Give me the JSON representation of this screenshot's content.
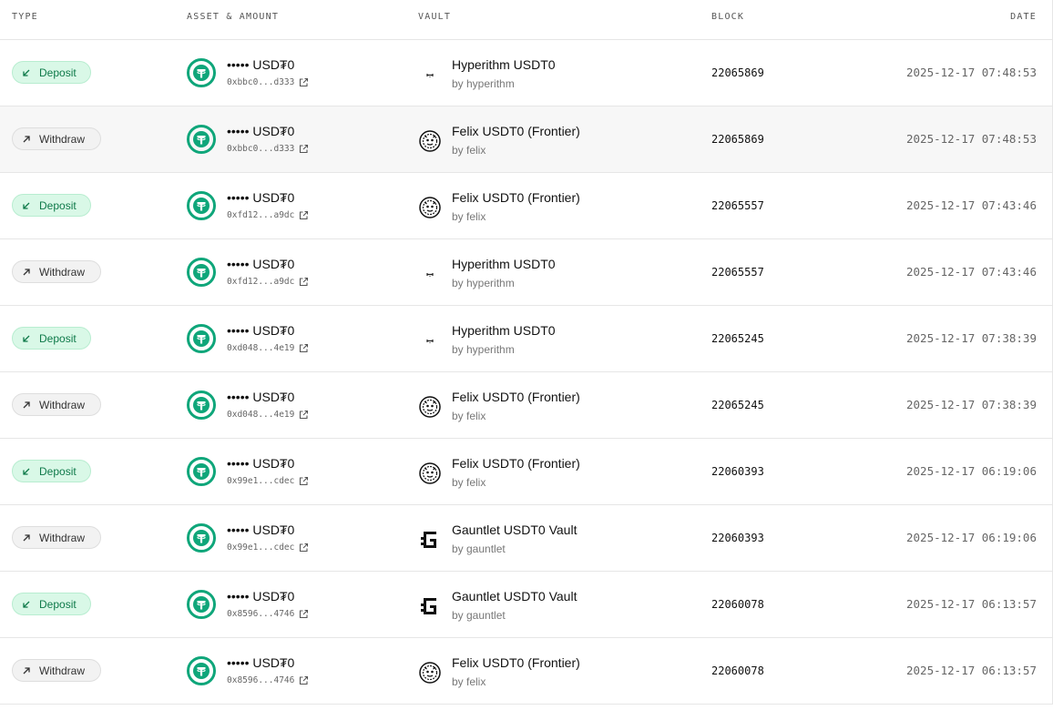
{
  "header": {
    "type": "TYPE",
    "asset": "ASSET & AMOUNT",
    "vault": "VAULT",
    "block": "BLOCK",
    "date": "DATE"
  },
  "colors": {
    "deposit_bg": "#d9f8e7",
    "deposit_text": "#0f7a4a",
    "withdraw_bg": "#f2f2f2",
    "tether_green": "#0fa67a"
  },
  "rows": [
    {
      "type": "Deposit",
      "kind": "deposit",
      "amount": "••••• USD₮0",
      "addr": "0xbbc0...d333",
      "vault": "Hyperithm USDT0",
      "by": "by hyperithm",
      "vault_icon": "hyperithm",
      "block": "22065869",
      "date": "2025-12-17 07:48:53"
    },
    {
      "type": "Withdraw",
      "kind": "withdraw",
      "amount": "••••• USD₮0",
      "addr": "0xbbc0...d333",
      "vault": "Felix USDT0 (Frontier)",
      "by": "by felix",
      "vault_icon": "felix",
      "block": "22065869",
      "date": "2025-12-17 07:48:53"
    },
    {
      "type": "Deposit",
      "kind": "deposit",
      "amount": "••••• USD₮0",
      "addr": "0xfd12...a9dc",
      "vault": "Felix USDT0 (Frontier)",
      "by": "by felix",
      "vault_icon": "felix",
      "block": "22065557",
      "date": "2025-12-17 07:43:46"
    },
    {
      "type": "Withdraw",
      "kind": "withdraw",
      "amount": "••••• USD₮0",
      "addr": "0xfd12...a9dc",
      "vault": "Hyperithm USDT0",
      "by": "by hyperithm",
      "vault_icon": "hyperithm",
      "block": "22065557",
      "date": "2025-12-17 07:43:46"
    },
    {
      "type": "Deposit",
      "kind": "deposit",
      "amount": "••••• USD₮0",
      "addr": "0xd048...4e19",
      "vault": "Hyperithm USDT0",
      "by": "by hyperithm",
      "vault_icon": "hyperithm",
      "block": "22065245",
      "date": "2025-12-17 07:38:39"
    },
    {
      "type": "Withdraw",
      "kind": "withdraw",
      "amount": "••••• USD₮0",
      "addr": "0xd048...4e19",
      "vault": "Felix USDT0 (Frontier)",
      "by": "by felix",
      "vault_icon": "felix",
      "block": "22065245",
      "date": "2025-12-17 07:38:39"
    },
    {
      "type": "Deposit",
      "kind": "deposit",
      "amount": "••••• USD₮0",
      "addr": "0x99e1...cdec",
      "vault": "Felix USDT0 (Frontier)",
      "by": "by felix",
      "vault_icon": "felix",
      "block": "22060393",
      "date": "2025-12-17 06:19:06"
    },
    {
      "type": "Withdraw",
      "kind": "withdraw",
      "amount": "••••• USD₮0",
      "addr": "0x99e1...cdec",
      "vault": "Gauntlet USDT0 Vault",
      "by": "by gauntlet",
      "vault_icon": "gauntlet",
      "block": "22060393",
      "date": "2025-12-17 06:19:06"
    },
    {
      "type": "Deposit",
      "kind": "deposit",
      "amount": "••••• USD₮0",
      "addr": "0x8596...4746",
      "vault": "Gauntlet USDT0 Vault",
      "by": "by gauntlet",
      "vault_icon": "gauntlet",
      "block": "22060078",
      "date": "2025-12-17 06:13:57"
    },
    {
      "type": "Withdraw",
      "kind": "withdraw",
      "amount": "••••• USD₮0",
      "addr": "0x8596...4746",
      "vault": "Felix USDT0 (Frontier)",
      "by": "by felix",
      "vault_icon": "felix",
      "block": "22060078",
      "date": "2025-12-17 06:13:57"
    }
  ]
}
